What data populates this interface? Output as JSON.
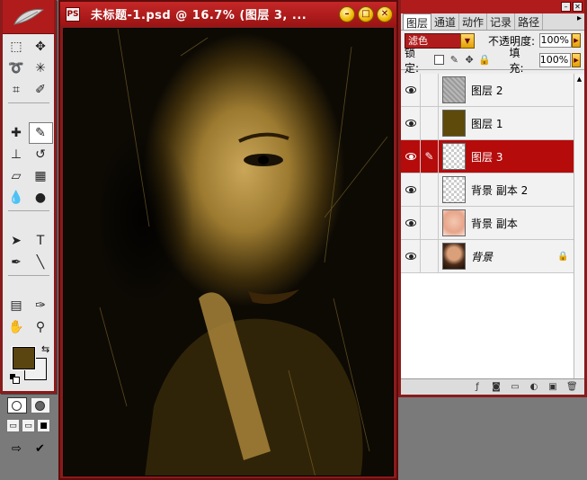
{
  "document": {
    "title": "未标题-1.psd @ 16.7% (图层 3, ...",
    "ps_icon": "PS",
    "buttons": [
      "minimize-icon",
      "maximize-icon",
      "close-icon"
    ]
  },
  "toolbox": {
    "foreground_color": "#5a4510",
    "background_color": "#f0f0f0",
    "tools": [
      {
        "name": "marquee-tool",
        "glyph": "⬚"
      },
      {
        "name": "move-tool",
        "glyph": "✥"
      },
      {
        "name": "lasso-tool",
        "glyph": "➰"
      },
      {
        "name": "magic-wand-tool",
        "glyph": "✳"
      },
      {
        "name": "crop-tool",
        "glyph": "⌗"
      },
      {
        "name": "slice-tool",
        "glyph": "✐"
      },
      {
        "name": "healing-brush-tool",
        "glyph": "✚"
      },
      {
        "name": "brush-tool",
        "glyph": "✎"
      },
      {
        "name": "clone-stamp-tool",
        "glyph": "⊥"
      },
      {
        "name": "history-brush-tool",
        "glyph": "↺"
      },
      {
        "name": "eraser-tool",
        "glyph": "▱"
      },
      {
        "name": "gradient-tool",
        "glyph": "▦"
      },
      {
        "name": "blur-tool",
        "glyph": "💧"
      },
      {
        "name": "dodge-tool",
        "glyph": "●"
      },
      {
        "name": "path-selection-tool",
        "glyph": "➤"
      },
      {
        "name": "type-tool",
        "glyph": "T"
      },
      {
        "name": "pen-tool",
        "glyph": "✒"
      },
      {
        "name": "line-tool",
        "glyph": "╲"
      },
      {
        "name": "notes-tool",
        "glyph": "▤"
      },
      {
        "name": "eyedropper-tool",
        "glyph": "✑"
      },
      {
        "name": "hand-tool",
        "glyph": "✋"
      },
      {
        "name": "zoom-tool",
        "glyph": "⚲"
      }
    ]
  },
  "layers_panel": {
    "tabs": [
      {
        "label": "图层",
        "active": true
      },
      {
        "label": "通道",
        "active": false
      },
      {
        "label": "动作",
        "active": false
      },
      {
        "label": "记录",
        "active": false
      },
      {
        "label": "路径",
        "active": false
      }
    ],
    "blend_mode": "滤色",
    "opacity_label": "不透明度:",
    "opacity_value": "100%",
    "lock_label": "锁定:",
    "fill_label": "填充:",
    "fill_value": "100%",
    "layers": [
      {
        "name": "图层 2",
        "thumb": "gray",
        "selected": false,
        "brush": false,
        "locked": false,
        "italic": false
      },
      {
        "name": "图层 1",
        "thumb": "olive",
        "selected": false,
        "brush": false,
        "locked": false,
        "italic": false
      },
      {
        "name": "图层 3",
        "thumb": "checker",
        "selected": true,
        "brush": true,
        "locked": false,
        "italic": false
      },
      {
        "name": "背景 副本 2",
        "thumb": "checker",
        "selected": false,
        "brush": false,
        "locked": false,
        "italic": false
      },
      {
        "name": "背景 副本",
        "thumb": "peach",
        "selected": false,
        "brush": false,
        "locked": false,
        "italic": false
      },
      {
        "name": "背景",
        "thumb": "photo",
        "selected": false,
        "brush": false,
        "locked": true,
        "italic": true
      }
    ],
    "bottom_icons": [
      "layer-style-icon",
      "layer-mask-icon",
      "new-group-icon",
      "adjustment-layer-icon",
      "new-layer-icon",
      "trash-icon"
    ]
  }
}
